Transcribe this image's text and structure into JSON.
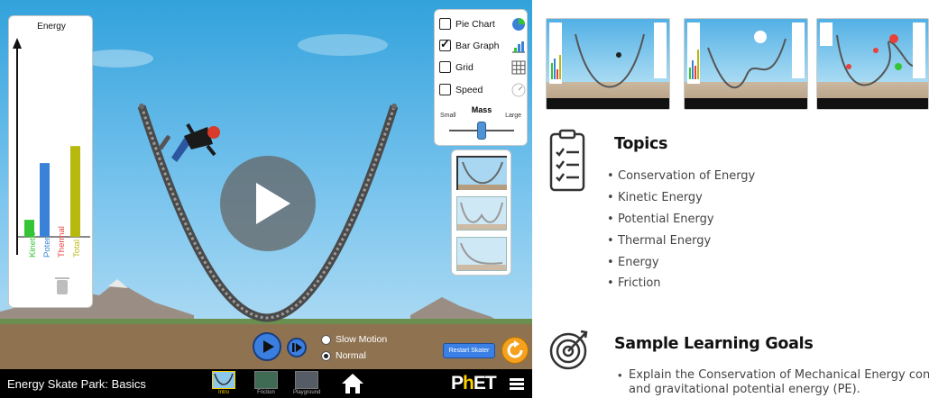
{
  "sim": {
    "title": "Energy Skate Park: Basics",
    "energy_panel": {
      "title": "Energy",
      "bars": [
        {
          "label": "Kinetic",
          "value": 0.09,
          "color": "#35c435"
        },
        {
          "label": "Potential",
          "value": 0.39,
          "color": "#3a82d8"
        },
        {
          "label": "Thermal",
          "value": 0.0,
          "color": "#e8403a"
        },
        {
          "label": "Total",
          "value": 0.48,
          "color": "#b8b90f"
        }
      ]
    },
    "controls": {
      "pie_chart": "Pie Chart",
      "bar_graph": "Bar Graph",
      "grid": "Grid",
      "speed": "Speed",
      "pie_checked": false,
      "bar_checked": true,
      "grid_checked": false,
      "speed_checked": false,
      "mass_title": "Mass",
      "mass_small": "Small",
      "mass_large": "Large",
      "mass_level": 0.5
    },
    "tracks": [
      "valley",
      "double-well",
      "ramp"
    ],
    "speed_options": {
      "slow": "Slow Motion",
      "normal": "Normal",
      "selected": "Normal"
    },
    "restart_label": "Restart Skater",
    "screens": [
      {
        "label": "Intro",
        "active": true
      },
      {
        "label": "Friction",
        "active": false
      },
      {
        "label": "Playground",
        "active": false
      }
    ],
    "logo": {
      "p": "P",
      "h": "h",
      "et": "ET"
    },
    "accent_color": "#ffd200"
  },
  "info": {
    "topics_title": "Topics",
    "topics": [
      "Conservation of Energy",
      "Kinetic Energy",
      "Potential Energy",
      "Thermal Energy",
      "Energy",
      "Friction"
    ],
    "goals_title": "Sample Learning Goals",
    "goals": [
      "Explain the Conservation of Mechanical Energy concep",
      "and gravitational potential energy (PE)."
    ],
    "icons": [
      "checklist-icon",
      "target-icon"
    ]
  }
}
